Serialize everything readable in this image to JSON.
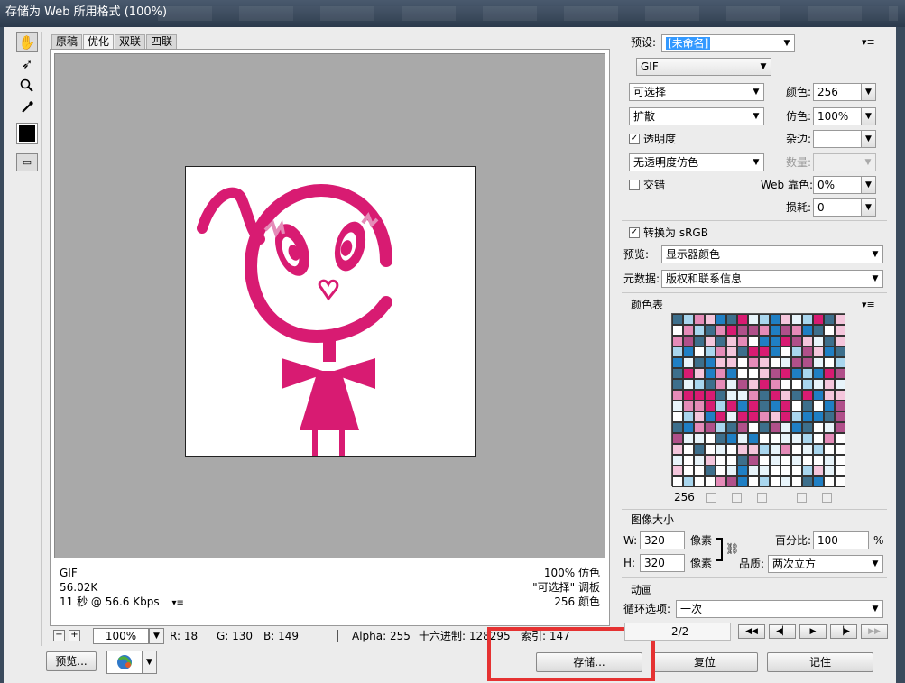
{
  "window": {
    "title": "存储为 Web 所用格式 (100%)"
  },
  "tabs": [
    {
      "label": "原稿",
      "active": false
    },
    {
      "label": "优化",
      "active": true
    },
    {
      "label": "双联",
      "active": false
    },
    {
      "label": "四联",
      "active": false
    }
  ],
  "tools": [
    "hand-icon",
    "slice-select-icon",
    "zoom-icon",
    "eyedropper-icon"
  ],
  "image_info": {
    "format": "GIF",
    "size": "56.02K",
    "time": "11 秒 @ 56.6 Kbps",
    "dither": "100% 仿色",
    "palette": "\"可选择\" 调板",
    "colors": "256 颜色"
  },
  "status": {
    "zoom": "100%",
    "r": "R: 18",
    "g": "G: 130",
    "b": "B: 149",
    "alpha": "Alpha: 255",
    "hex": "十六进制: 128295",
    "index": "索引: 147"
  },
  "buttons": {
    "preview": "预览...",
    "save": "存储...",
    "reset": "复位",
    "remember": "记住"
  },
  "settings": {
    "preset_label": "预设:",
    "preset_value": "[未命名]",
    "format": "GIF",
    "reduction": "可选择",
    "dither_algo": "扩散",
    "transparency_label": "透明度",
    "transparency_checked": true,
    "transparency_dither": "无透明度仿色",
    "interlaced_label": "交错",
    "interlaced_checked": false,
    "colors_label": "颜色:",
    "colors_value": "256",
    "dither_label": "仿色:",
    "dither_value": "100%",
    "matte_label": "杂边:",
    "matte_value": "",
    "amount_label": "数量:",
    "websnap_label": "Web 靠色:",
    "websnap_value": "0%",
    "lossy_label": "损耗:",
    "lossy_value": "0",
    "srgb_label": "转换为 sRGB",
    "srgb_checked": true,
    "preview_label": "预览:",
    "preview_value": "显示器颜色",
    "metadata_label": "元数据:",
    "metadata_value": "版权和联系信息"
  },
  "color_table": {
    "title": "颜色表",
    "count": "256",
    "colors": {
      "magenta": "#d81b72",
      "pink": "#e58bb8",
      "lightpink": "#f4c6dc",
      "blue": "#1f7fc4",
      "teal": "#3d6f8c",
      "lightblue": "#a9d6ee",
      "white": "#ffffff",
      "palecyan": "#e8f4fa",
      "mauve": "#b0508a"
    }
  },
  "image_size": {
    "title": "图像大小",
    "w_label": "W:",
    "w_value": "320",
    "h_label": "H:",
    "h_value": "320",
    "unit": "像素",
    "percent_label": "百分比:",
    "percent_value": "100",
    "percent_unit": "%",
    "quality_label": "品质:",
    "quality_value": "两次立方"
  },
  "animation": {
    "title": "动画",
    "loop_label": "循环选项:",
    "loop_value": "一次",
    "frame": "2/2"
  }
}
